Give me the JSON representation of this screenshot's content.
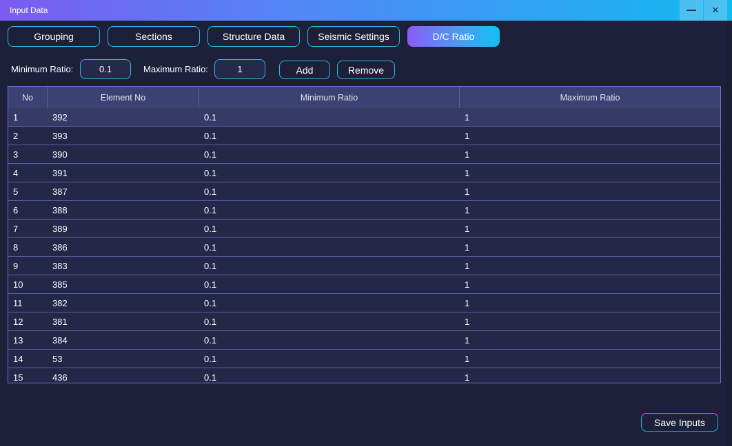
{
  "window": {
    "title": "Input Data",
    "close_glyph": "✕"
  },
  "tabs": [
    {
      "label": "Grouping",
      "active": false
    },
    {
      "label": "Sections",
      "active": false
    },
    {
      "label": "Structure Data",
      "active": false
    },
    {
      "label": "Seismic Settings",
      "active": false
    },
    {
      "label": "D/C Ratio",
      "active": true
    }
  ],
  "ratio_form": {
    "min_label": "Minimum Ratio:",
    "min_value": "0.1",
    "max_label": "Maximum Ratio:",
    "max_value": "1",
    "add_label": "Add",
    "remove_label": "Remove"
  },
  "table": {
    "columns": [
      "No",
      "Element No",
      "Minimum Ratio",
      "Maximum Ratio"
    ],
    "selected_row": 0,
    "rows": [
      [
        "1",
        "392",
        "0.1",
        "1"
      ],
      [
        "2",
        "393",
        "0.1",
        "1"
      ],
      [
        "3",
        "390",
        "0.1",
        "1"
      ],
      [
        "4",
        "391",
        "0.1",
        "1"
      ],
      [
        "5",
        "387",
        "0.1",
        "1"
      ],
      [
        "6",
        "388",
        "0.1",
        "1"
      ],
      [
        "7",
        "389",
        "0.1",
        "1"
      ],
      [
        "8",
        "386",
        "0.1",
        "1"
      ],
      [
        "9",
        "383",
        "0.1",
        "1"
      ],
      [
        "10",
        "385",
        "0.1",
        "1"
      ],
      [
        "11",
        "382",
        "0.1",
        "1"
      ],
      [
        "12",
        "381",
        "0.1",
        "1"
      ],
      [
        "13",
        "384",
        "0.1",
        "1"
      ],
      [
        "14",
        "53",
        "0.1",
        "1"
      ],
      [
        "15",
        "436",
        "0.1",
        "1"
      ]
    ]
  },
  "footer": {
    "save_label": "Save Inputs"
  },
  "colors": {
    "accent_border": "#2fb3e8",
    "background": "#1c2038",
    "table_border": "#7a6cd6"
  }
}
